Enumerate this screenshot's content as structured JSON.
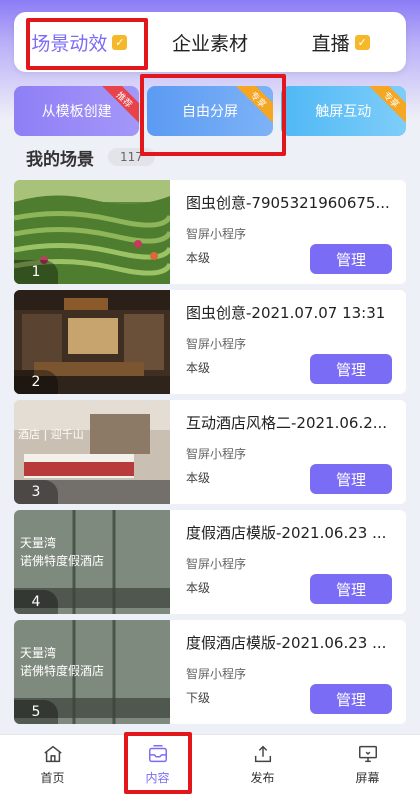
{
  "tabs": [
    {
      "label": "场景动效",
      "checked": true
    },
    {
      "label": "企业素材",
      "checked": false
    },
    {
      "label": "直播",
      "checked": true
    }
  ],
  "modes": [
    {
      "label": "从模板创建",
      "corner": "推荐"
    },
    {
      "label": "自由分屏",
      "corner": "专享"
    },
    {
      "label": "触屏互动",
      "corner": "专享"
    }
  ],
  "section": {
    "title": "我的场景",
    "count": "117"
  },
  "scenes": [
    {
      "num": "1",
      "title": "图虫创意-7905321960675...",
      "sub": "智屏小程序",
      "level": "本级",
      "button": "管理"
    },
    {
      "num": "2",
      "title": "图虫创意-2021.07.07 13:31",
      "sub": "智屏小程序",
      "level": "本级",
      "button": "管理"
    },
    {
      "num": "3",
      "title": "互动酒店风格二-2021.06.2...",
      "sub": "智屏小程序",
      "level": "本级",
      "button": "管理"
    },
    {
      "num": "4",
      "title": "度假酒店模版-2021.06.23 ...",
      "sub": "智屏小程序",
      "level": "本级",
      "button": "管理"
    },
    {
      "num": "5",
      "title": "度假酒店模版-2021.06.23 ...",
      "sub": "智屏小程序",
      "level": "下级",
      "button": "管理"
    }
  ],
  "thumb_text": {
    "t3": "酒店 | 迎千山",
    "t4a": "天量湾",
    "t4b": "诺佛特度假酒店",
    "t5a": "天量湾",
    "t5b": "诺佛特度假酒店"
  },
  "nav": [
    {
      "label": "首页",
      "icon": "home-icon"
    },
    {
      "label": "内容",
      "icon": "inbox-icon"
    },
    {
      "label": "发布",
      "icon": "upload-icon"
    },
    {
      "label": "屏幕",
      "icon": "monitor-icon"
    }
  ],
  "colors": {
    "accent": "#7b6cf6",
    "highlight": "#e2171c",
    "badge": "#f5b82a"
  }
}
